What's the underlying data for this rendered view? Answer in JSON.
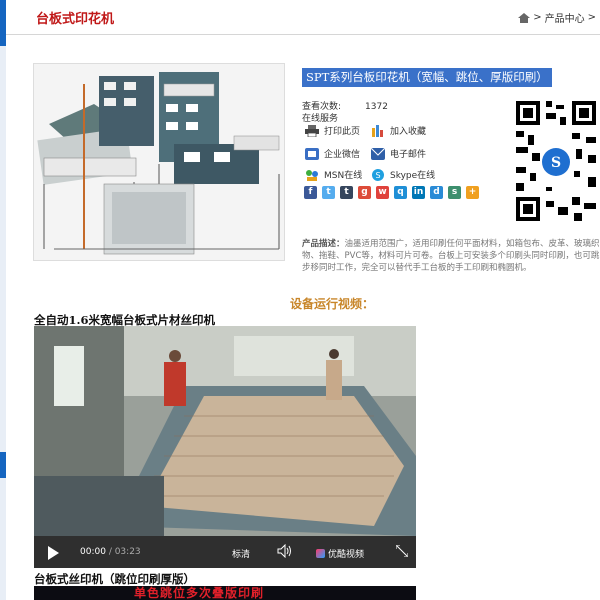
{
  "header": {
    "title": "台板式印花机",
    "breadcrumb": [
      "产品中心",
      ">"
    ]
  },
  "product": {
    "title": "SPT系列台板印花机（宽幅、跳位、厚版印刷）",
    "views_label": "查看次数:",
    "views_count": "1372",
    "online_label": "在线服务",
    "actions": [
      {
        "label": "打印此页",
        "icon": "printer-icon"
      },
      {
        "label": "加入收藏",
        "icon": "bookmark-icon"
      },
      {
        "label": "企业微信",
        "icon": "wechat-icon"
      },
      {
        "label": "电子邮件",
        "icon": "email-icon"
      },
      {
        "label": "MSN在线",
        "icon": "msn-icon"
      },
      {
        "label": "Skype在线",
        "icon": "skype-icon"
      }
    ],
    "description_label": "产品描述：",
    "description": "油墨适用范围广，适用印刷任何平面材料，如箱包布、皮革、玻璃织物、拖鞋、PVC等，材料可片可卷。台板上可安装多个印刷头同时印刷，也可跳步移同时工作，完全可以替代手工台板的手工印刷和椭圆机。"
  },
  "video_section": {
    "heading": "设备运行视频：",
    "video1_caption": "全自动1.6米宽幅台板式片材丝印机",
    "current_time": "00:00",
    "duration": "/ 03:23",
    "quality": "标清",
    "brand": "优酷视频",
    "video2_caption": "台板式丝印机（跳位印刷厚版）",
    "video2_overlay": "单色跳位多次叠版印刷"
  },
  "colors": {
    "accent_red": "#c01818",
    "title_bg": "#3a71c9",
    "section_heading": "#c8862a"
  }
}
